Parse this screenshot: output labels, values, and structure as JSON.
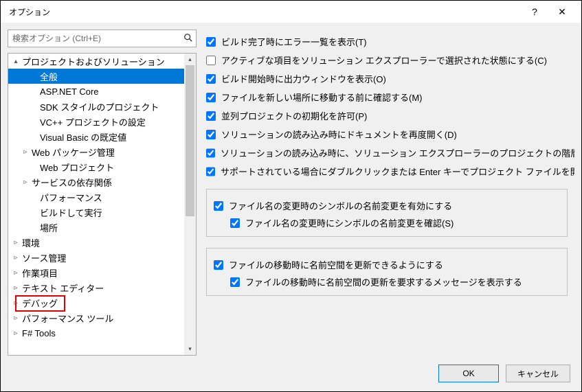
{
  "titlebar": {
    "title": "オプション"
  },
  "search": {
    "placeholder": "検索オプション (Ctrl+E)"
  },
  "tree": {
    "items": [
      {
        "label": "プロジェクトおよびソリューション",
        "depth": 0,
        "expander": "▴",
        "selected": false
      },
      {
        "label": "全般",
        "depth": 2,
        "expander": "",
        "selected": true
      },
      {
        "label": "ASP.NET Core",
        "depth": 2,
        "expander": "",
        "selected": false
      },
      {
        "label": "SDK スタイルのプロジェクト",
        "depth": 2,
        "expander": "",
        "selected": false
      },
      {
        "label": "VC++ プロジェクトの設定",
        "depth": 2,
        "expander": "",
        "selected": false
      },
      {
        "label": "Visual Basic の既定値",
        "depth": 2,
        "expander": "",
        "selected": false
      },
      {
        "label": "Web パッケージ管理",
        "depth": 1,
        "expander": "▹",
        "selected": false
      },
      {
        "label": "Web プロジェクト",
        "depth": 2,
        "expander": "",
        "selected": false
      },
      {
        "label": "サービスの依存関係",
        "depth": 1,
        "expander": "▹",
        "selected": false
      },
      {
        "label": "パフォーマンス",
        "depth": 2,
        "expander": "",
        "selected": false
      },
      {
        "label": "ビルドして実行",
        "depth": 2,
        "expander": "",
        "selected": false
      },
      {
        "label": "場所",
        "depth": 2,
        "expander": "",
        "selected": false
      },
      {
        "label": "環境",
        "depth": 0,
        "expander": "▹",
        "selected": false
      },
      {
        "label": "ソース管理",
        "depth": 0,
        "expander": "▹",
        "selected": false
      },
      {
        "label": "作業項目",
        "depth": 0,
        "expander": "▹",
        "selected": false
      },
      {
        "label": "テキスト エディター",
        "depth": 0,
        "expander": "▹",
        "selected": false
      },
      {
        "label": "デバッグ",
        "depth": 0,
        "expander": "▹",
        "selected": false
      },
      {
        "label": "パフォーマンス ツール",
        "depth": 0,
        "expander": "▹",
        "selected": false
      },
      {
        "label": "F# Tools",
        "depth": 0,
        "expander": "▹",
        "selected": false
      }
    ]
  },
  "checks": {
    "c1": "ビルド完了時にエラー一覧を表示(T)",
    "c2": "アクティブな項目をソリューション エクスプローラーで選択された状態にする(C)",
    "c3": "ビルド開始時に出力ウィンドウを表示(O)",
    "c4": "ファイルを新しい場所に移動する前に確認する(M)",
    "c5": "並列プロジェクトの初期化を許可(P)",
    "c6": "ソリューションの読み込み時にドキュメントを再度開く(D)",
    "c7": "ソリューションの読み込み時に、ソリューション エクスプローラーのプロジェクトの階層状態を復元する(R)",
    "c8": "サポートされている場合にダブルクリックまたは Enter キーでプロジェクト ファイルを開く(F)"
  },
  "group1": {
    "g1": "ファイル名の変更時のシンボルの名前変更を有効にする",
    "g2": "ファイル名の変更時にシンボルの名前変更を確認(S)"
  },
  "group2": {
    "g1": "ファイルの移動時に名前空間を更新できるようにする",
    "g2": "ファイルの移動時に名前空間の更新を要求するメッセージを表示する"
  },
  "footer": {
    "ok": "OK",
    "cancel": "キャンセル"
  }
}
